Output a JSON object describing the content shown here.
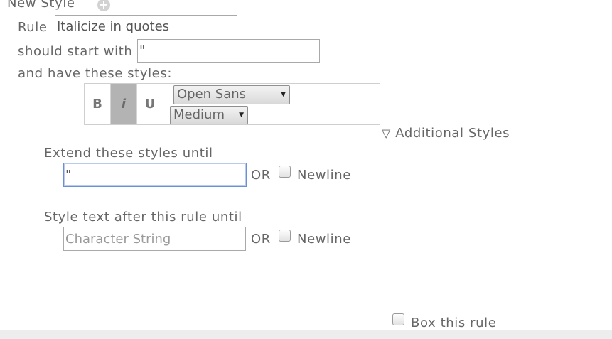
{
  "header": {
    "title": "New Style",
    "add_icon": "plus-circle-icon"
  },
  "rule": {
    "label": "Rule",
    "name_value": "Italicize in quotes",
    "start_label": "should start with",
    "start_value": "\"",
    "styles_label": "and have these styles:"
  },
  "toolbar": {
    "bold_label": "B",
    "italic_label": "i",
    "underline_label": "U",
    "italic_active": true,
    "font_family": "Open Sans",
    "font_size": "Medium",
    "active_color": "#b3b3b3"
  },
  "additional_styles": {
    "icon": "triangle-down-outline-icon",
    "label": "Additional Styles"
  },
  "extend": {
    "label": "Extend these styles until",
    "value": "\"",
    "or_label": "OR",
    "newline_label": "Newline",
    "newline_checked": false
  },
  "after": {
    "label": "Style text after this rule until",
    "value": "",
    "placeholder": "Character String",
    "or_label": "OR",
    "newline_label": "Newline",
    "newline_checked": false
  },
  "box_rule": {
    "label": "Box this rule",
    "checked": false
  }
}
